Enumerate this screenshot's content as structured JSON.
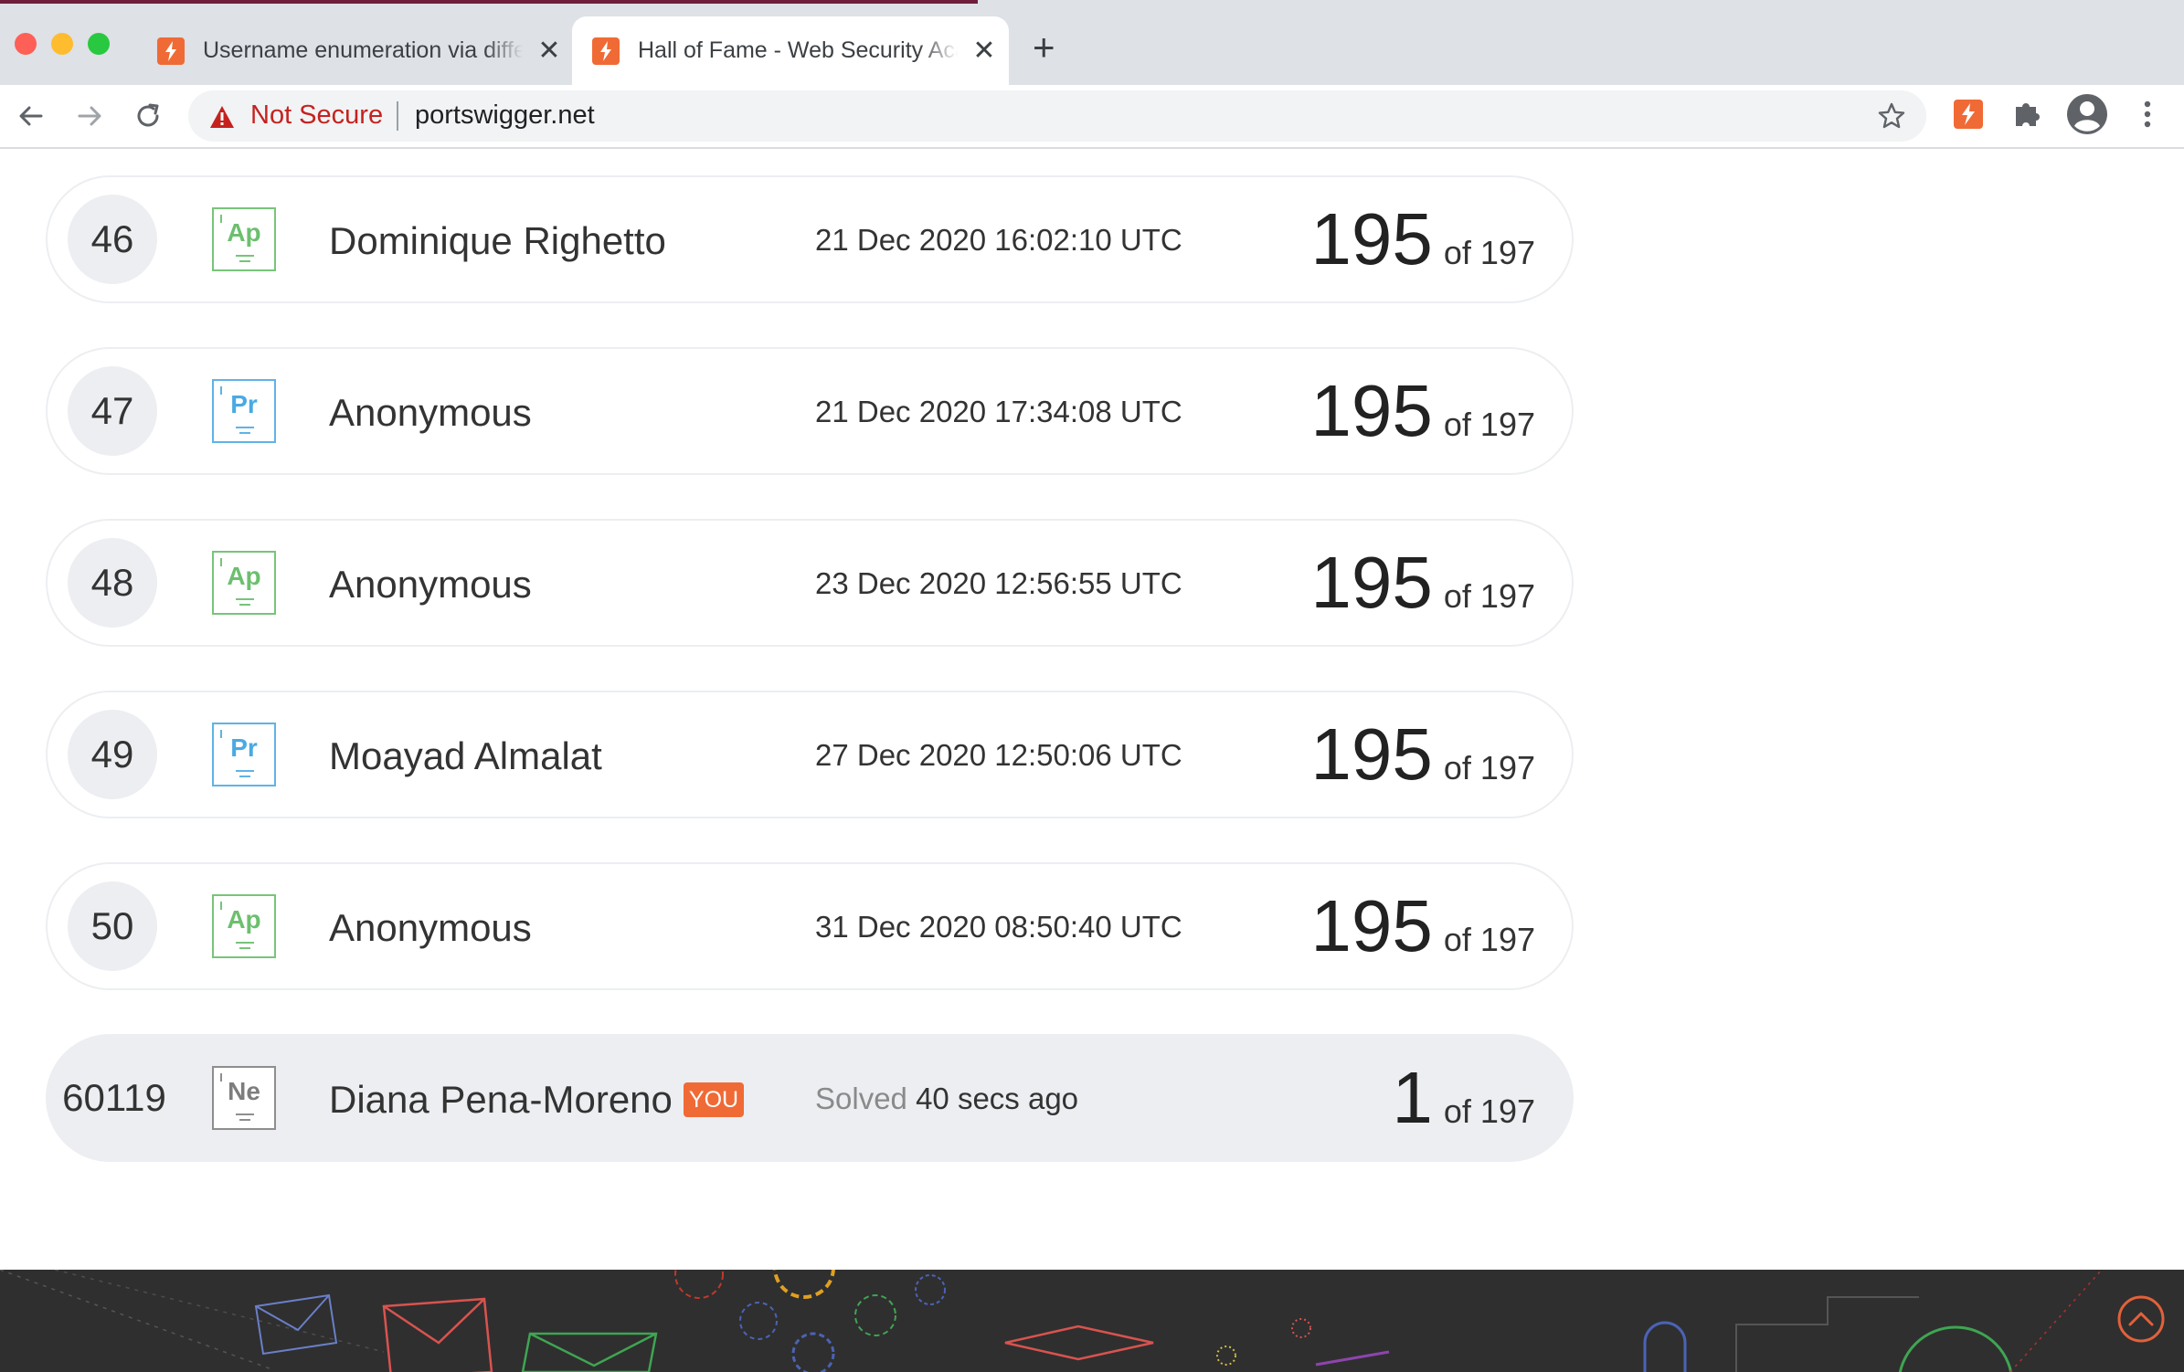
{
  "browser": {
    "tabs": [
      {
        "title": "Username enumeration via different responses | Web Security Academy",
        "close": "✕"
      },
      {
        "title": "Hall of Fame - Web Security Academy",
        "close": "✕"
      }
    ],
    "new_tab": "+",
    "security_label": "Not Secure",
    "url": "portswigger.net"
  },
  "leaderboard": [
    {
      "rank": "46",
      "badge": "Ap",
      "name": "Dominique Righetto",
      "date": "21 Dec 2020 16:02:10 UTC",
      "score": "195",
      "of": "of 197"
    },
    {
      "rank": "47",
      "badge": "Pr",
      "name": "Anonymous",
      "date": "21 Dec 2020 17:34:08 UTC",
      "score": "195",
      "of": "of 197"
    },
    {
      "rank": "48",
      "badge": "Ap",
      "name": "Anonymous",
      "date": "23 Dec 2020 12:56:55 UTC",
      "score": "195",
      "of": "of 197"
    },
    {
      "rank": "49",
      "badge": "Pr",
      "name": "Moayad Almalat",
      "date": "27 Dec 2020 12:50:06 UTC",
      "score": "195",
      "of": "of 197"
    },
    {
      "rank": "50",
      "badge": "Ap",
      "name": "Anonymous",
      "date": "31 Dec 2020 08:50:40 UTC",
      "score": "195",
      "of": "of 197"
    }
  ],
  "current_user": {
    "rank": "60119",
    "badge": "Ne",
    "name": "Diana Pena-Moreno",
    "you_tag": "YOU",
    "solved_label": "Solved",
    "solved_time": "40 secs ago",
    "score": "1",
    "of": "of 197"
  },
  "colors": {
    "accent": "#f06a35",
    "badge_ap": "#78c47a",
    "badge_pr": "#5fb3e6",
    "badge_ne": "#8e8e8e",
    "not_secure": "#c5221f",
    "footer_bg": "#2f2f2f"
  },
  "icons": [
    "back-arrow-icon",
    "forward-arrow-icon",
    "reload-icon",
    "warning-icon",
    "bookmark-star-icon",
    "burp-extension-icon",
    "extensions-puzzle-icon",
    "profile-avatar-icon",
    "menu-kebab-icon",
    "scroll-to-top-icon"
  ]
}
